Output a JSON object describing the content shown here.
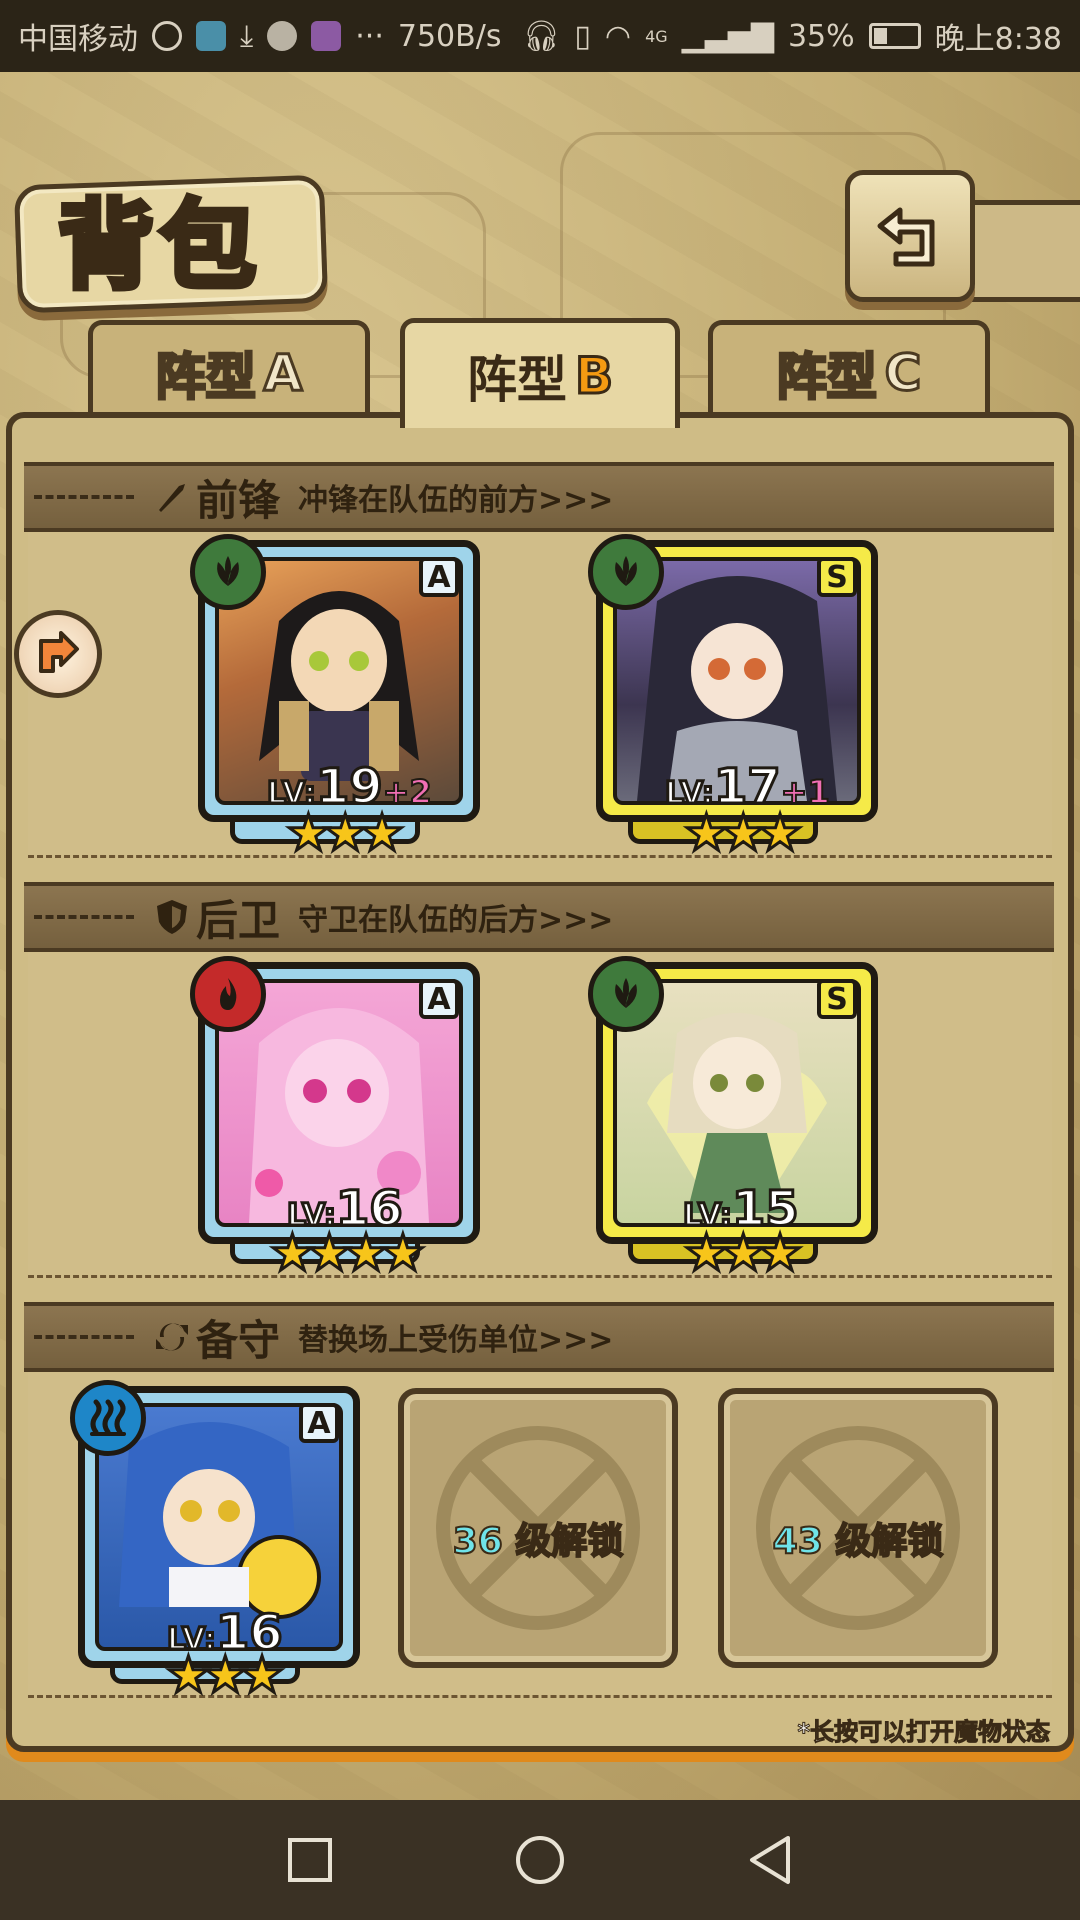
{
  "status_bar": {
    "carrier": "中国移动",
    "speed": "750B/s",
    "network": "4G",
    "battery": "35%",
    "time": "晚上8:38",
    "icons": [
      "alarm-icon",
      "app-icon",
      "download-icon",
      "wechat-icon",
      "app-icon",
      "headphones-icon",
      "vibrate-icon",
      "wifi-icon",
      "signal-icon",
      "battery-icon"
    ]
  },
  "header": {
    "title": "背包",
    "back_icon": "return-arrow-icon"
  },
  "tabs": [
    {
      "label": "阵型",
      "letter": "A",
      "active": false
    },
    {
      "label": "阵型",
      "letter": "B",
      "active": true
    },
    {
      "label": "阵型",
      "letter": "C",
      "active": false
    }
  ],
  "sections": {
    "front": {
      "icon": "sword-icon",
      "title": "前锋",
      "desc": "冲锋在队伍的前方>>>"
    },
    "back": {
      "icon": "shield-icon",
      "title": "后卫",
      "desc": "守卫在队伍的后方>>>"
    },
    "reserve": {
      "icon": "swap-icon",
      "title": "备守",
      "desc": "替换场上受伤单位>>>"
    }
  },
  "units": {
    "front_1": {
      "element": "leaf",
      "rank": "A",
      "lv_prefix": "LV:",
      "level": "19",
      "bonus": "+2",
      "stars": 3,
      "accent": "#9fd4ea"
    },
    "front_2": {
      "element": "leaf",
      "rank": "S",
      "lv_prefix": "LV:",
      "level": "17",
      "bonus": "+1",
      "stars": 3,
      "accent": "#f5ea48"
    },
    "back_1": {
      "element": "fire",
      "rank": "A",
      "lv_prefix": "LV:",
      "level": "16",
      "bonus": "",
      "stars": 4,
      "accent": "#9fd4ea"
    },
    "back_2": {
      "element": "leaf",
      "rank": "S",
      "lv_prefix": "LV:",
      "level": "15",
      "bonus": "",
      "stars": 3,
      "accent": "#f5ea48"
    },
    "reserve_1": {
      "element": "water",
      "rank": "A",
      "lv_prefix": "LV:",
      "level": "16",
      "bonus": "",
      "stars": 3,
      "accent": "#9fd4ea"
    }
  },
  "locked_slots": [
    {
      "level": "36",
      "label": "级解锁"
    },
    {
      "level": "43",
      "label": "级解锁"
    }
  ],
  "footnote": "*长按可以打开魔物状态",
  "colors": {
    "panel": "#cfbc86",
    "border": "#4b3a22",
    "active_letter": "#f49a12",
    "rank_a": "#9fd4ea",
    "rank_s": "#f5ea48"
  }
}
